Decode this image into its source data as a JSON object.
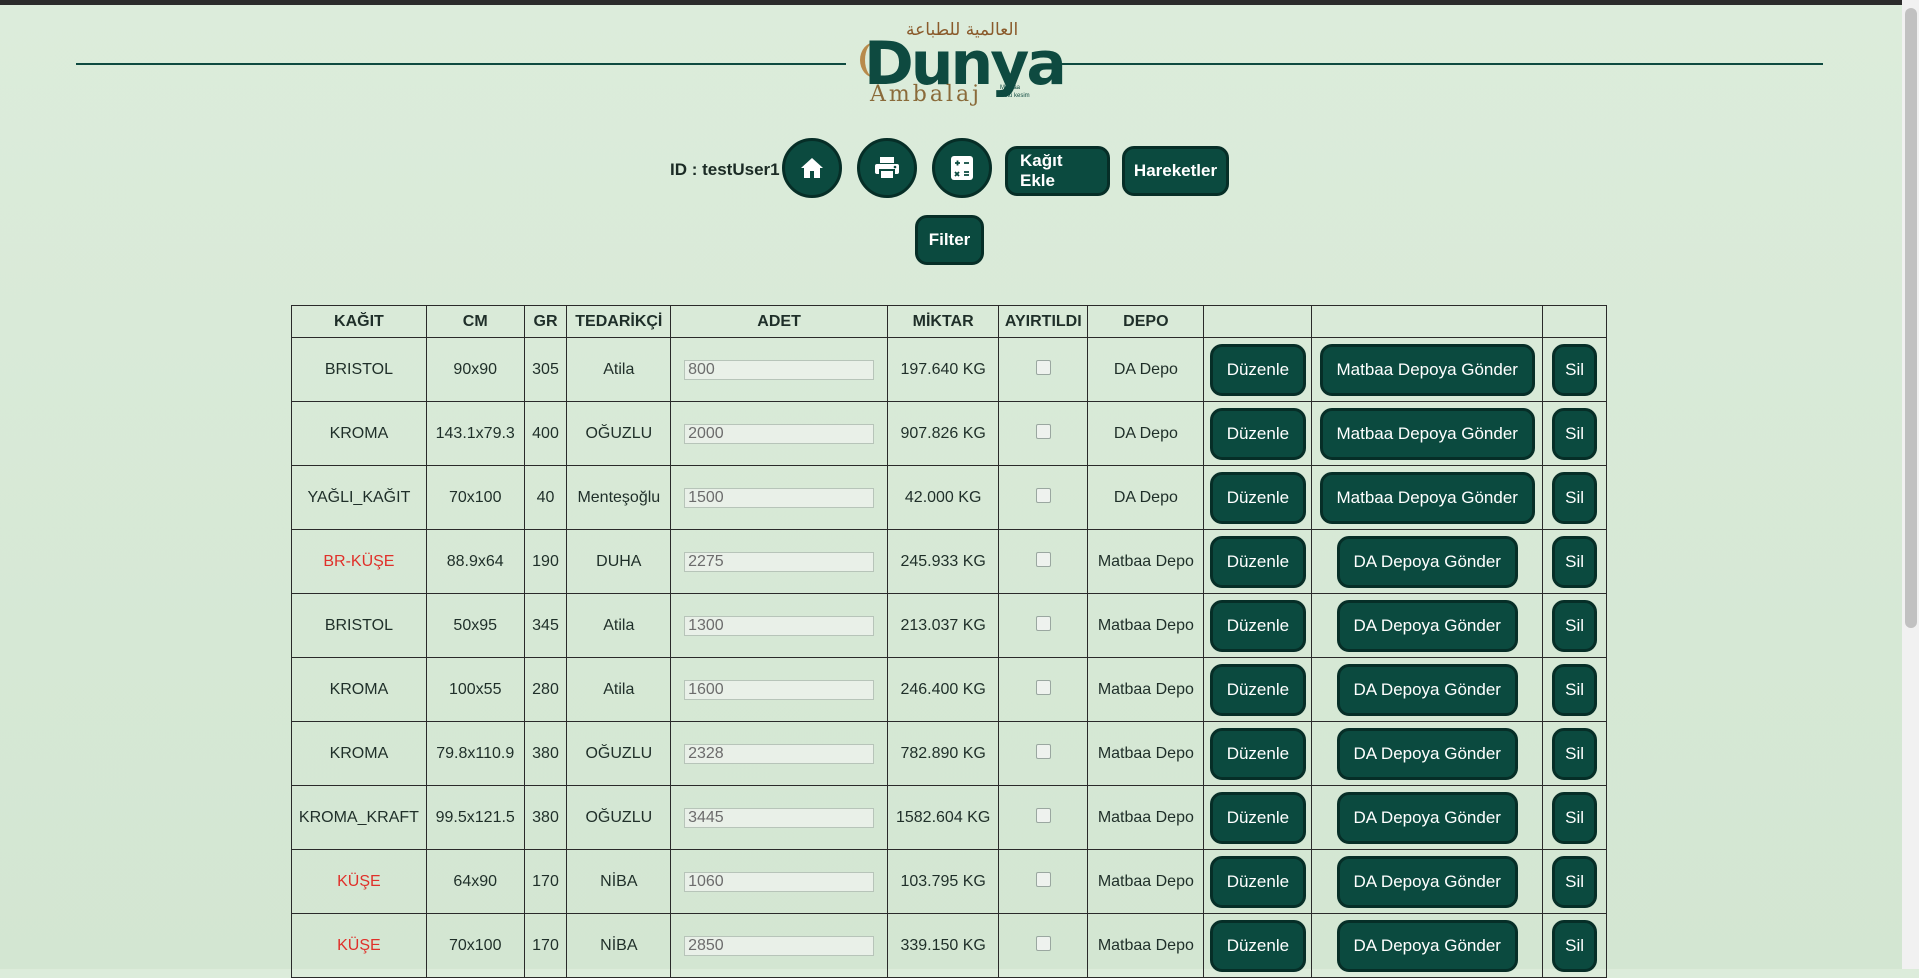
{
  "header": {
    "logo_arabic": "العالمية للطباعة",
    "logo_main": "Dunya",
    "logo_sub": "Ambalaj",
    "logo_tagline": "Matbaa\nKutu kesim"
  },
  "toolbar": {
    "id_label": "ID : testUser1",
    "home_icon": "home-icon",
    "print_icon": "printer-icon",
    "calc_icon": "calculator-icon",
    "add_paper": "Kağıt Ekle",
    "movements": "Hareketler",
    "filter": "Filter"
  },
  "colors": {
    "primary": "#0b4a3f",
    "background": "#d5e8d4",
    "alert": "#e0302a"
  },
  "table": {
    "headers": [
      "KAĞIT",
      "CM",
      "GR",
      "TEDARİKÇİ",
      "ADET",
      "MİKTAR",
      "AYIRTILDI",
      "DEPO",
      "",
      "",
      ""
    ],
    "edit_label": "Düzenle",
    "delete_label": "Sil",
    "rows": [
      {
        "kagit": "BRISTOL",
        "cm": "90x90",
        "gr": "305",
        "tedarikci": "Atila",
        "adet": "800",
        "miktar": "197.640 KG",
        "depo": "DA Depo",
        "send": "Matbaa Depoya Gönder",
        "red": false
      },
      {
        "kagit": "KROMA",
        "cm": "143.1x79.3",
        "gr": "400",
        "tedarikci": "OĞUZLU",
        "adet": "2000",
        "miktar": "907.826 KG",
        "depo": "DA Depo",
        "send": "Matbaa Depoya Gönder",
        "red": false
      },
      {
        "kagit": "YAĞLI_KAĞIT",
        "cm": "70x100",
        "gr": "40",
        "tedarikci": "Menteşoğlu",
        "adet": "1500",
        "miktar": "42.000 KG",
        "depo": "DA Depo",
        "send": "Matbaa Depoya Gönder",
        "red": false
      },
      {
        "kagit": "BR-KÜŞE",
        "cm": "88.9x64",
        "gr": "190",
        "tedarikci": "DUHA",
        "adet": "2275",
        "miktar": "245.933 KG",
        "depo": "Matbaa Depo",
        "send": "DA Depoya Gönder",
        "red": true
      },
      {
        "kagit": "BRISTOL",
        "cm": "50x95",
        "gr": "345",
        "tedarikci": "Atila",
        "adet": "1300",
        "miktar": "213.037 KG",
        "depo": "Matbaa Depo",
        "send": "DA Depoya Gönder",
        "red": false
      },
      {
        "kagit": "KROMA",
        "cm": "100x55",
        "gr": "280",
        "tedarikci": "Atila",
        "adet": "1600",
        "miktar": "246.400 KG",
        "depo": "Matbaa Depo",
        "send": "DA Depoya Gönder",
        "red": false
      },
      {
        "kagit": "KROMA",
        "cm": "79.8x110.9",
        "gr": "380",
        "tedarikci": "OĞUZLU",
        "adet": "2328",
        "miktar": "782.890 KG",
        "depo": "Matbaa Depo",
        "send": "DA Depoya Gönder",
        "red": false
      },
      {
        "kagit": "KROMA_KRAFT",
        "cm": "99.5x121.5",
        "gr": "380",
        "tedarikci": "OĞUZLU",
        "adet": "3445",
        "miktar": "1582.604 KG",
        "depo": "Matbaa Depo",
        "send": "DA Depoya Gönder",
        "red": false
      },
      {
        "kagit": "KÜŞE",
        "cm": "64x90",
        "gr": "170",
        "tedarikci": "NİBA",
        "adet": "1060",
        "miktar": "103.795 KG",
        "depo": "Matbaa Depo",
        "send": "DA Depoya Gönder",
        "red": true
      },
      {
        "kagit": "KÜŞE",
        "cm": "70x100",
        "gr": "170",
        "tedarikci": "NİBA",
        "adet": "2850",
        "miktar": "339.150 KG",
        "depo": "Matbaa Depo",
        "send": "DA Depoya Gönder",
        "red": true
      }
    ]
  }
}
